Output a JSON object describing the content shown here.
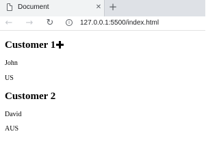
{
  "browser": {
    "tab": {
      "title": "Document",
      "close_glyph": "✕",
      "icon": "document-icon"
    },
    "new_tab_glyph": "+",
    "toolbar": {
      "back_glyph": "←",
      "forward_glyph": "→",
      "reload_glyph": "↻",
      "info_glyph": "i",
      "url": "127.0.0.1:5500/index.html"
    }
  },
  "page": {
    "sections": [
      {
        "heading": "Customer 1",
        "lines": [
          "John",
          "US"
        ]
      },
      {
        "heading": "Customer 2",
        "lines": [
          "David",
          "AUS"
        ]
      }
    ]
  },
  "cursor": "move-cursor-icon"
}
